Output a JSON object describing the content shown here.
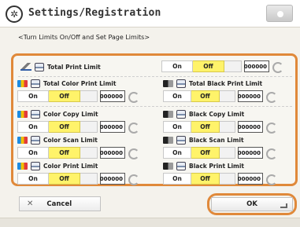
{
  "header": {
    "title": "Settings/Registration"
  },
  "subtitle": "<Turn Limits On/Off and Set Page Limits>",
  "rows": [
    {
      "id": "total-print",
      "label": "Total Print Limit",
      "on": "On",
      "off": "Off",
      "value": "000000",
      "icon": "pencil-icon"
    },
    {
      "id": "total-color-print",
      "label": "Total Color Print Limit",
      "on": "On",
      "off": "Off",
      "value": "000000",
      "icon": "color-icon"
    },
    {
      "id": "total-black-print",
      "label": "Total Black Print Limit",
      "on": "On",
      "off": "Off",
      "value": "000000",
      "icon": "black-icon"
    },
    {
      "id": "color-copy",
      "label": "Color Copy Limit",
      "on": "On",
      "off": "Off",
      "value": "000000",
      "icon": "color-icon"
    },
    {
      "id": "black-copy",
      "label": "Black Copy Limit",
      "on": "On",
      "off": "Off",
      "value": "000000",
      "icon": "black-icon"
    },
    {
      "id": "color-scan",
      "label": "Color Scan Limit",
      "on": "On",
      "off": "Off",
      "value": "000000",
      "icon": "color-icon"
    },
    {
      "id": "black-scan",
      "label": "Black Scan Limit",
      "on": "On",
      "off": "Off",
      "value": "000000",
      "icon": "black-icon"
    },
    {
      "id": "color-print",
      "label": "Color Print Limit",
      "on": "On",
      "off": "Off",
      "value": "000000",
      "icon": "color-icon"
    },
    {
      "id": "black-print",
      "label": "Black Print Limit",
      "on": "On",
      "off": "Off",
      "value": "000000",
      "icon": "black-icon"
    }
  ],
  "selected_state": "Off",
  "footer": {
    "cancel_label": "Cancel",
    "ok_label": "OK"
  },
  "colors": {
    "accent": "#e0893a",
    "selected": "#fff36a"
  }
}
